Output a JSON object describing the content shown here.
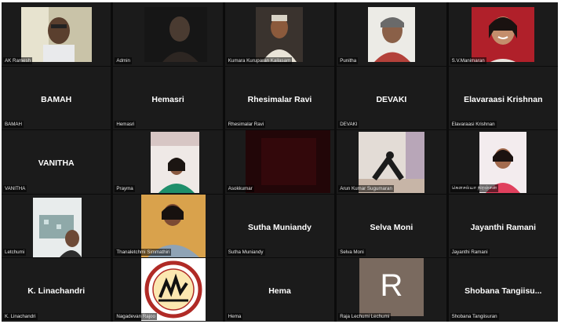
{
  "participants": [
    {
      "label": "AK Ramesh"
    },
    {
      "label": "Admin"
    },
    {
      "label": "Kumara Kuruparan Kailasam"
    },
    {
      "label": "Punitha"
    },
    {
      "label": "S.V.Manimaran"
    },
    {
      "label": "BAMAH",
      "big": "BAMAH"
    },
    {
      "label": "Hemasri",
      "big": "Hemasri"
    },
    {
      "label": "Rhesimalar Ravi",
      "big": "Rhesimalar Ravi"
    },
    {
      "label": "DEVAKI",
      "big": "DEVAKI"
    },
    {
      "label": "Elavaraasi Krishnan",
      "big": "Elavaraasi Krishnan"
    },
    {
      "label": "VANITHA",
      "big": "VANITHA"
    },
    {
      "label": "Prayma"
    },
    {
      "label": "Asokkumar"
    },
    {
      "label": "Arun Kumar Sugumaran"
    },
    {
      "label": "கௌசல்யா நிரஞ்சன்"
    },
    {
      "label": "Letchumi"
    },
    {
      "label": "Thanaletchmi Simmathiri"
    },
    {
      "label": "Sutha Muniandy",
      "big": "Sutha Muniandy"
    },
    {
      "label": "Selva Moni",
      "big": "Selva Moni"
    },
    {
      "label": "Jayanthi Ramani",
      "big": "Jayanthi Ramani"
    },
    {
      "label": "K. Linachandri",
      "big": "K. Linachandri"
    },
    {
      "label": "Nagadevan Rajoo"
    },
    {
      "label": "Hema",
      "big": "Hema"
    },
    {
      "label": "Raja Lechumi Lechumi",
      "avatar_letter": "R"
    },
    {
      "label": "Shobana Tangiisuran",
      "big": "Shobana  Tangiisu..."
    }
  ],
  "colors": {
    "background": "#0b0b0b",
    "tile": "#1b1b1b",
    "avatar": "#7a6a5f"
  }
}
